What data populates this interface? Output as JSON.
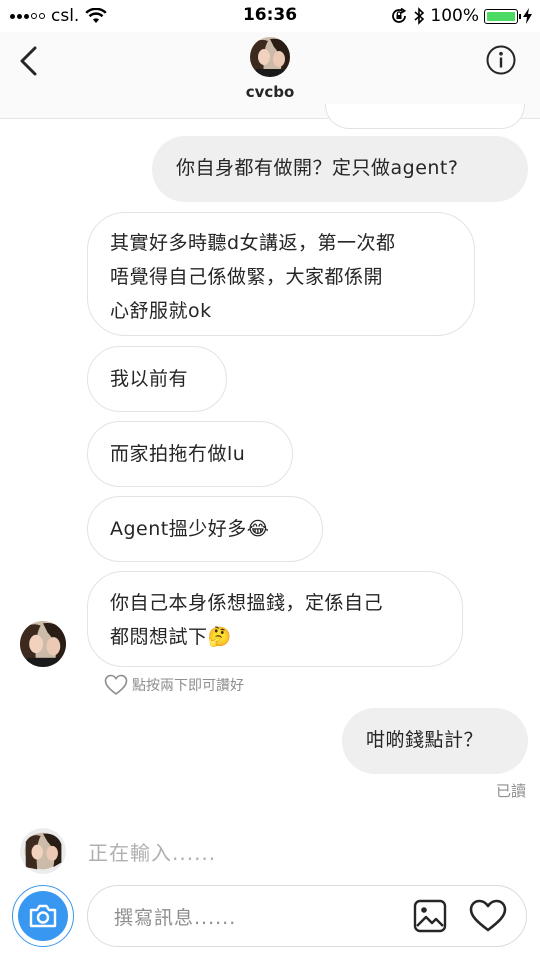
{
  "status_bar": {
    "carrier": "csl.",
    "time": "16:36",
    "battery": "100%",
    "battery_level": 1.0
  },
  "header": {
    "username": "cvcbo"
  },
  "messages": [
    {
      "side": "out",
      "text": "你自身都有做開？定只做agent?"
    },
    {
      "side": "in",
      "lines": [
        "其實好多時聽d女講返，第一次都",
        "唔覺得自己係做緊，大家都係開",
        "心舒服就ok"
      ]
    },
    {
      "side": "in",
      "text": "我以前有"
    },
    {
      "side": "in",
      "text": "而家拍拖冇做lu"
    },
    {
      "side": "in",
      "text": "Agent搵少好多",
      "emoji": "😂"
    },
    {
      "side": "in",
      "lines": [
        "你自己本身係想搵錢，定係自己",
        "都悶想試下"
      ],
      "emoji": "🤔"
    },
    {
      "side": "out",
      "text": "咁啲錢點計？"
    }
  ],
  "like_hint": "點按兩下即可讚好",
  "read_receipt": "已讀",
  "typing_indicator": "正在輸入......",
  "composer": {
    "placeholder": "撰寫訊息......"
  },
  "colors": {
    "accent": "#3897f0",
    "bubble_out": "#efefef",
    "bubble_border": "#e3e3e3",
    "muted": "#8e8e8e"
  },
  "icons": [
    "back-arrow-icon",
    "info-icon",
    "camera-icon",
    "gallery-icon",
    "heart-icon",
    "wifi-icon",
    "bluetooth-icon",
    "orientation-lock-icon",
    "charging-icon"
  ]
}
